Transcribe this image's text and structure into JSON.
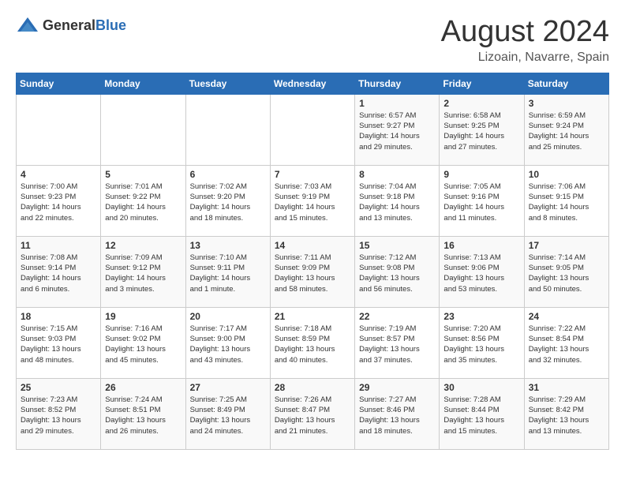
{
  "logo": {
    "general": "General",
    "blue": "Blue"
  },
  "title": "August 2024",
  "location": "Lizoain, Navarre, Spain",
  "weekdays": [
    "Sunday",
    "Monday",
    "Tuesday",
    "Wednesday",
    "Thursday",
    "Friday",
    "Saturday"
  ],
  "weeks": [
    [
      {
        "day": "",
        "info": ""
      },
      {
        "day": "",
        "info": ""
      },
      {
        "day": "",
        "info": ""
      },
      {
        "day": "",
        "info": ""
      },
      {
        "day": "1",
        "info": "Sunrise: 6:57 AM\nSunset: 9:27 PM\nDaylight: 14 hours\nand 29 minutes."
      },
      {
        "day": "2",
        "info": "Sunrise: 6:58 AM\nSunset: 9:25 PM\nDaylight: 14 hours\nand 27 minutes."
      },
      {
        "day": "3",
        "info": "Sunrise: 6:59 AM\nSunset: 9:24 PM\nDaylight: 14 hours\nand 25 minutes."
      }
    ],
    [
      {
        "day": "4",
        "info": "Sunrise: 7:00 AM\nSunset: 9:23 PM\nDaylight: 14 hours\nand 22 minutes."
      },
      {
        "day": "5",
        "info": "Sunrise: 7:01 AM\nSunset: 9:22 PM\nDaylight: 14 hours\nand 20 minutes."
      },
      {
        "day": "6",
        "info": "Sunrise: 7:02 AM\nSunset: 9:20 PM\nDaylight: 14 hours\nand 18 minutes."
      },
      {
        "day": "7",
        "info": "Sunrise: 7:03 AM\nSunset: 9:19 PM\nDaylight: 14 hours\nand 15 minutes."
      },
      {
        "day": "8",
        "info": "Sunrise: 7:04 AM\nSunset: 9:18 PM\nDaylight: 14 hours\nand 13 minutes."
      },
      {
        "day": "9",
        "info": "Sunrise: 7:05 AM\nSunset: 9:16 PM\nDaylight: 14 hours\nand 11 minutes."
      },
      {
        "day": "10",
        "info": "Sunrise: 7:06 AM\nSunset: 9:15 PM\nDaylight: 14 hours\nand 8 minutes."
      }
    ],
    [
      {
        "day": "11",
        "info": "Sunrise: 7:08 AM\nSunset: 9:14 PM\nDaylight: 14 hours\nand 6 minutes."
      },
      {
        "day": "12",
        "info": "Sunrise: 7:09 AM\nSunset: 9:12 PM\nDaylight: 14 hours\nand 3 minutes."
      },
      {
        "day": "13",
        "info": "Sunrise: 7:10 AM\nSunset: 9:11 PM\nDaylight: 14 hours\nand 1 minute."
      },
      {
        "day": "14",
        "info": "Sunrise: 7:11 AM\nSunset: 9:09 PM\nDaylight: 13 hours\nand 58 minutes."
      },
      {
        "day": "15",
        "info": "Sunrise: 7:12 AM\nSunset: 9:08 PM\nDaylight: 13 hours\nand 56 minutes."
      },
      {
        "day": "16",
        "info": "Sunrise: 7:13 AM\nSunset: 9:06 PM\nDaylight: 13 hours\nand 53 minutes."
      },
      {
        "day": "17",
        "info": "Sunrise: 7:14 AM\nSunset: 9:05 PM\nDaylight: 13 hours\nand 50 minutes."
      }
    ],
    [
      {
        "day": "18",
        "info": "Sunrise: 7:15 AM\nSunset: 9:03 PM\nDaylight: 13 hours\nand 48 minutes."
      },
      {
        "day": "19",
        "info": "Sunrise: 7:16 AM\nSunset: 9:02 PM\nDaylight: 13 hours\nand 45 minutes."
      },
      {
        "day": "20",
        "info": "Sunrise: 7:17 AM\nSunset: 9:00 PM\nDaylight: 13 hours\nand 43 minutes."
      },
      {
        "day": "21",
        "info": "Sunrise: 7:18 AM\nSunset: 8:59 PM\nDaylight: 13 hours\nand 40 minutes."
      },
      {
        "day": "22",
        "info": "Sunrise: 7:19 AM\nSunset: 8:57 PM\nDaylight: 13 hours\nand 37 minutes."
      },
      {
        "day": "23",
        "info": "Sunrise: 7:20 AM\nSunset: 8:56 PM\nDaylight: 13 hours\nand 35 minutes."
      },
      {
        "day": "24",
        "info": "Sunrise: 7:22 AM\nSunset: 8:54 PM\nDaylight: 13 hours\nand 32 minutes."
      }
    ],
    [
      {
        "day": "25",
        "info": "Sunrise: 7:23 AM\nSunset: 8:52 PM\nDaylight: 13 hours\nand 29 minutes."
      },
      {
        "day": "26",
        "info": "Sunrise: 7:24 AM\nSunset: 8:51 PM\nDaylight: 13 hours\nand 26 minutes."
      },
      {
        "day": "27",
        "info": "Sunrise: 7:25 AM\nSunset: 8:49 PM\nDaylight: 13 hours\nand 24 minutes."
      },
      {
        "day": "28",
        "info": "Sunrise: 7:26 AM\nSunset: 8:47 PM\nDaylight: 13 hours\nand 21 minutes."
      },
      {
        "day": "29",
        "info": "Sunrise: 7:27 AM\nSunset: 8:46 PM\nDaylight: 13 hours\nand 18 minutes."
      },
      {
        "day": "30",
        "info": "Sunrise: 7:28 AM\nSunset: 8:44 PM\nDaylight: 13 hours\nand 15 minutes."
      },
      {
        "day": "31",
        "info": "Sunrise: 7:29 AM\nSunset: 8:42 PM\nDaylight: 13 hours\nand 13 minutes."
      }
    ]
  ]
}
